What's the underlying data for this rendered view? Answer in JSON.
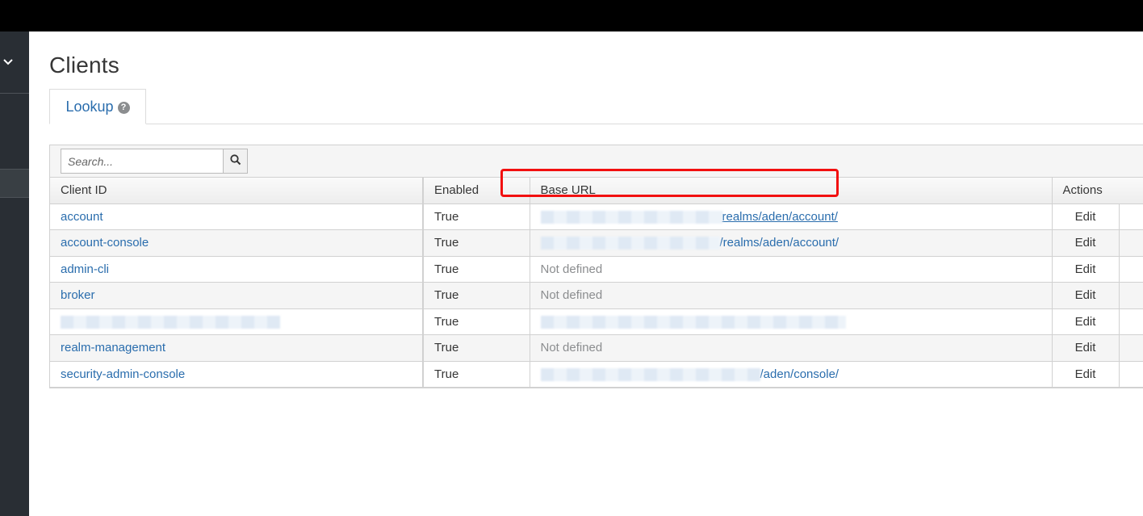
{
  "page": {
    "title": "Clients"
  },
  "tabs": [
    {
      "label": "Lookup",
      "active": true
    }
  ],
  "search": {
    "placeholder": "Search...",
    "value": ""
  },
  "table": {
    "columns": [
      "Client ID",
      "Enabled",
      "Base URL",
      "Actions"
    ],
    "rows": [
      {
        "client_id": "account",
        "enabled": "True",
        "base_url": "realms/aden/account/",
        "base_url_redacted": true,
        "action": "Edit"
      },
      {
        "client_id": "account-console",
        "enabled": "True",
        "base_url": "/realms/aden/account/",
        "base_url_redacted": true,
        "action": "Edit"
      },
      {
        "client_id": "admin-cli",
        "enabled": "True",
        "base_url": "Not defined",
        "base_url_redacted": false,
        "action": "Edit"
      },
      {
        "client_id": "broker",
        "enabled": "True",
        "base_url": "Not defined",
        "base_url_redacted": false,
        "action": "Edit"
      },
      {
        "client_id": "",
        "client_id_redacted": true,
        "enabled": "True",
        "base_url": "",
        "base_url_redacted": true,
        "action": "Edit"
      },
      {
        "client_id": "realm-management",
        "enabled": "True",
        "base_url": "Not defined",
        "base_url_redacted": false,
        "action": "Edit"
      },
      {
        "client_id": "security-admin-console",
        "enabled": "True",
        "base_url": "/aden/console/",
        "base_url_redacted": true,
        "action": "Edit"
      }
    ]
  },
  "colors": {
    "link": "#2a6dad",
    "highlight": "#f21010",
    "topbar": "#000000",
    "sidebar": "#292e34"
  },
  "icons": {
    "sidebar_toggle": "chevron-down-icon",
    "help": "question-circle-icon",
    "search": "search-icon"
  }
}
